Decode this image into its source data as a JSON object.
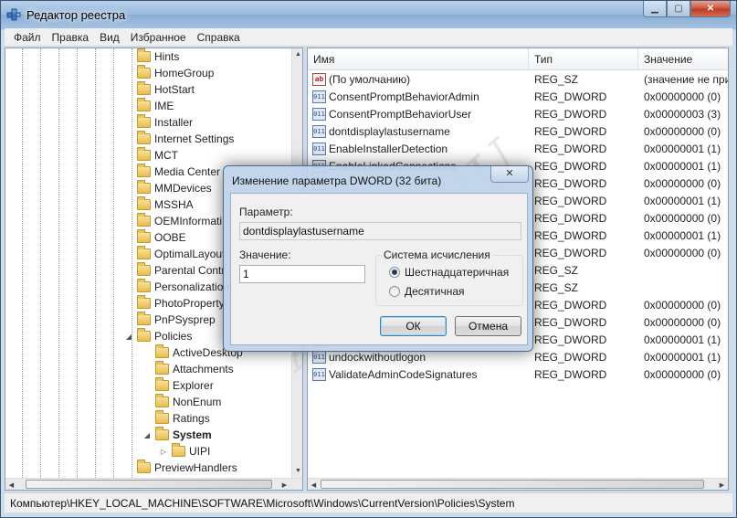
{
  "window": {
    "title": "Редактор реестра",
    "caption_buttons": [
      "minimize-icon",
      "maximize-icon",
      "close-icon"
    ]
  },
  "menu": [
    "Файл",
    "Правка",
    "Вид",
    "Избранное",
    "Справка"
  ],
  "tree": {
    "items": [
      {
        "label": "Hints",
        "level": 1,
        "selected": false
      },
      {
        "label": "HomeGroup",
        "level": 1,
        "selected": false
      },
      {
        "label": "HotStart",
        "level": 1,
        "selected": false
      },
      {
        "label": "IME",
        "level": 1,
        "selected": false
      },
      {
        "label": "Installer",
        "level": 1,
        "selected": false
      },
      {
        "label": "Internet Settings",
        "level": 1,
        "selected": false
      },
      {
        "label": "MCT",
        "level": 1,
        "selected": false
      },
      {
        "label": "Media Center",
        "level": 1,
        "selected": false
      },
      {
        "label": "MMDevices",
        "level": 1,
        "selected": false
      },
      {
        "label": "MSSHA",
        "level": 1,
        "selected": false
      },
      {
        "label": "OEMInformati",
        "level": 1,
        "selected": false
      },
      {
        "label": "OOBE",
        "level": 1,
        "selected": false
      },
      {
        "label": "OptimalLayout",
        "level": 1,
        "selected": false
      },
      {
        "label": "Parental Contr",
        "level": 1,
        "selected": false
      },
      {
        "label": "Personalization",
        "level": 1,
        "selected": false
      },
      {
        "label": "PhotoProperty",
        "level": 1,
        "selected": false
      },
      {
        "label": "PnPSysprep",
        "level": 1,
        "selected": false
      },
      {
        "label": "Policies",
        "level": 1,
        "selected": false,
        "expanded": true
      },
      {
        "label": "ActiveDesktop",
        "level": 2,
        "selected": false
      },
      {
        "label": "Attachments",
        "level": 2,
        "selected": false
      },
      {
        "label": "Explorer",
        "level": 2,
        "selected": false
      },
      {
        "label": "NonEnum",
        "level": 2,
        "selected": false
      },
      {
        "label": "Ratings",
        "level": 2,
        "selected": false
      },
      {
        "label": "System",
        "level": 2,
        "selected": true,
        "expanded": true
      },
      {
        "label": "UIPI",
        "level": 3,
        "selected": false
      },
      {
        "label": "PreviewHandlers",
        "level": 1,
        "selected": false
      }
    ]
  },
  "list": {
    "columns": [
      "Имя",
      "Тип",
      "Значение"
    ],
    "rows": [
      {
        "icon": "string-value-icon",
        "name": "(По умолчанию)",
        "type": "REG_SZ",
        "value": "(значение не при"
      },
      {
        "icon": "dword-value-icon",
        "name": "ConsentPromptBehaviorAdmin",
        "type": "REG_DWORD",
        "value": "0x00000000 (0)"
      },
      {
        "icon": "dword-value-icon",
        "name": "ConsentPromptBehaviorUser",
        "type": "REG_DWORD",
        "value": "0x00000003 (3)"
      },
      {
        "icon": "dword-value-icon",
        "name": "dontdisplaylastusername",
        "type": "REG_DWORD",
        "value": "0x00000000 (0)"
      },
      {
        "icon": "dword-value-icon",
        "name": "EnableInstallerDetection",
        "type": "REG_DWORD",
        "value": "0x00000001 (1)"
      },
      {
        "icon": "dword-value-icon",
        "name": "EnableLinkedConnections",
        "type": "REG_DWORD",
        "value": "0x00000001 (1)"
      },
      {
        "icon": "dword-value-icon",
        "name": "",
        "type": "REG_DWORD",
        "value": "0x00000000 (0)"
      },
      {
        "icon": "dword-value-icon",
        "name": "",
        "type": "REG_DWORD",
        "value": "0x00000001 (1)"
      },
      {
        "icon": "dword-value-icon",
        "name": "",
        "type": "REG_DWORD",
        "value": "0x00000000 (0)"
      },
      {
        "icon": "dword-value-icon",
        "name": "",
        "type": "REG_DWORD",
        "value": "0x00000001 (1)"
      },
      {
        "icon": "dword-value-icon",
        "name": "",
        "type": "REG_DWORD",
        "value": "0x00000000 (0)"
      },
      {
        "icon": "string-value-icon",
        "name": "",
        "type": "REG_SZ",
        "value": ""
      },
      {
        "icon": "string-value-icon",
        "name": "",
        "type": "REG_SZ",
        "value": ""
      },
      {
        "icon": "dword-value-icon",
        "name": "",
        "type": "REG_DWORD",
        "value": "0x00000000 (0)"
      },
      {
        "icon": "dword-value-icon",
        "name": "",
        "type": "REG_DWORD",
        "value": "0x00000000 (0)"
      },
      {
        "icon": "dword-value-icon",
        "name": "",
        "type": "REG_DWORD",
        "value": "0x00000001 (1)"
      },
      {
        "icon": "dword-value-icon",
        "name": "undockwithoutlogon",
        "type": "REG_DWORD",
        "value": "0x00000001 (1)"
      },
      {
        "icon": "dword-value-icon",
        "name": "ValidateAdminCodeSignatures",
        "type": "REG_DWORD",
        "value": "0x00000000 (0)"
      }
    ]
  },
  "status": "Компьютер\\HKEY_LOCAL_MACHINE\\SOFTWARE\\Microsoft\\Windows\\CurrentVersion\\Policies\\System",
  "dialog": {
    "title": "Изменение параметра DWORD (32 бита)",
    "param_label": "Параметр:",
    "param_value": "dontdisplaylastusername",
    "value_label": "Значение:",
    "value_input": "1",
    "base_label": "Система исчисления",
    "radio_hex": "Шестнадцатеричная",
    "radio_dec": "Десятичная",
    "selected_base": "hex",
    "ok": "ОК",
    "cancel": "Отмена"
  },
  "watermark": "All4OS.RU"
}
